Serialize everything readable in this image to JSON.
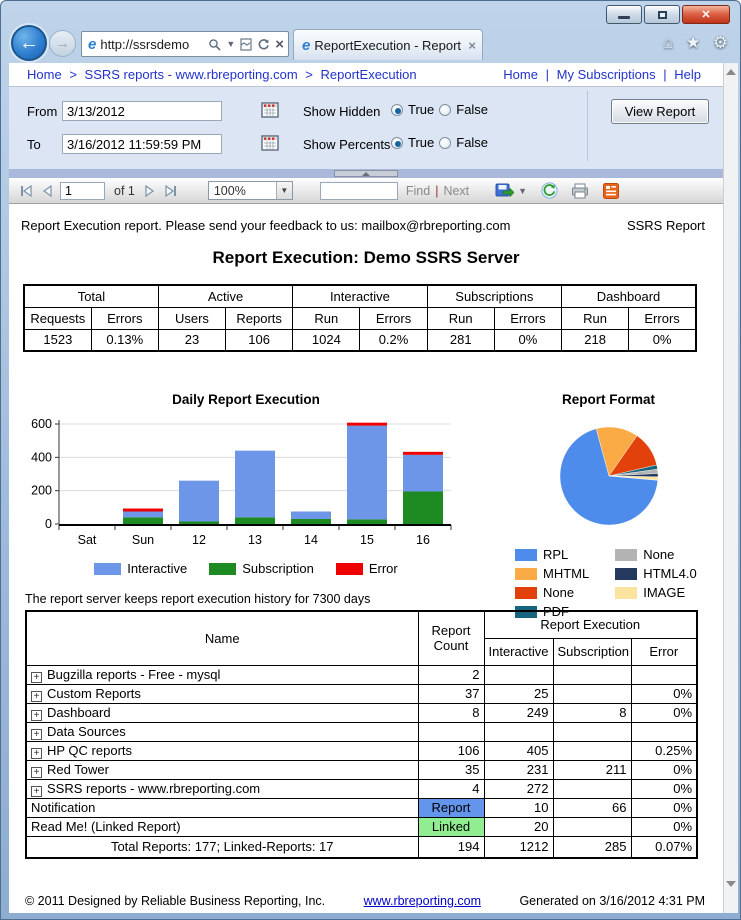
{
  "window": {
    "url": "http://ssrsdemo",
    "tab_title": "ReportExecution - Report ..."
  },
  "breadcrumb": {
    "items": [
      "Home",
      "SSRS reports - www.rbreporting.com",
      "ReportExecution"
    ],
    "separator": ">",
    "links": [
      "Home",
      "My Subscriptions",
      "Help"
    ],
    "link_separator": "|"
  },
  "params": {
    "from_label": "From",
    "from_value": "3/13/2012",
    "to_label": "To",
    "to_value": "3/16/2012 11:59:59 PM",
    "show_hidden_label": "Show Hidden",
    "show_percents_label": "Show Percents",
    "true_label": "True",
    "false_label": "False",
    "view_report_label": "View Report"
  },
  "toolbar": {
    "page_value": "1",
    "of_label": "of 1",
    "zoom_value": "100%",
    "find_label": "Find",
    "next_label": "Next",
    "find_next_separator": "|"
  },
  "report": {
    "feedback_line": "Report Execution report. Please send your feedback to us: mailbox@rbreporting.com",
    "type_label": "SSRS Report",
    "title": "Report Execution: Demo SSRS Server",
    "history_note": "The report server keeps report execution history for 7300 days"
  },
  "summary": {
    "groups": [
      {
        "label": "Total",
        "cols": [
          {
            "label": "Requests",
            "value": "1523"
          },
          {
            "label": "Errors",
            "value": "0.13%"
          }
        ]
      },
      {
        "label": "Active",
        "cols": [
          {
            "label": "Users",
            "value": "23"
          },
          {
            "label": "Reports",
            "value": "106"
          }
        ]
      },
      {
        "label": "Interactive",
        "cols": [
          {
            "label": "Run",
            "value": "1024"
          },
          {
            "label": "Errors",
            "value": "0.2%"
          }
        ]
      },
      {
        "label": "Subscriptions",
        "cols": [
          {
            "label": "Run",
            "value": "281"
          },
          {
            "label": "Errors",
            "value": "0%"
          }
        ]
      },
      {
        "label": "Dashboard",
        "cols": [
          {
            "label": "Run",
            "value": "218"
          },
          {
            "label": "Errors",
            "value": "0%"
          }
        ]
      }
    ]
  },
  "chart_data": [
    {
      "type": "bar",
      "stacked": true,
      "title": "Daily Report Execution",
      "categories": [
        "Sat",
        "Sun",
        "12",
        "13",
        "14",
        "15",
        "16"
      ],
      "series": [
        {
          "name": "Subscription",
          "color": "#1e8b22",
          "values": [
            0,
            40,
            15,
            40,
            30,
            28,
            195
          ]
        },
        {
          "name": "Interactive",
          "color": "#6d96e8",
          "values": [
            0,
            35,
            245,
            400,
            45,
            562,
            220
          ]
        },
        {
          "name": "Error",
          "color": "#ee0000",
          "values": [
            0,
            6,
            0,
            0,
            0,
            6,
            6
          ]
        }
      ],
      "legend_order": [
        "Interactive",
        "Subscription",
        "Error"
      ],
      "ylim": [
        0,
        600
      ],
      "yticks": [
        0,
        200,
        400,
        600
      ],
      "grid": true,
      "legend_position": "bottom"
    },
    {
      "type": "pie",
      "title": "Report Format",
      "start_angle": 95,
      "legend_position": "bottom",
      "slices": [
        {
          "label": "RPL",
          "value": 69.4,
          "color": "#4d8ceb"
        },
        {
          "label": "MHTML",
          "value": 13.9,
          "color": "#fbab45"
        },
        {
          "label": "None",
          "value": 11.7,
          "color": "#e2410c"
        },
        {
          "label": "PDF",
          "value": 1.4,
          "color": "#17647e"
        },
        {
          "label": "None",
          "value": 1.4,
          "color": "#b3b3b3"
        },
        {
          "label": "HTML4.0",
          "value": 1.1,
          "color": "#24395e"
        },
        {
          "label": "IMAGE",
          "value": 1.1,
          "color": "#fbe3a0"
        }
      ]
    }
  ],
  "table": {
    "name_header": "Name",
    "count_header": "Report Count",
    "exec_header": "Report Execution",
    "exec_cols": [
      "Interactive",
      "Subscription",
      "Error"
    ],
    "rows": [
      {
        "expand": true,
        "name": "Bugzilla reports - Free - mysql",
        "count": "2",
        "interactive": "",
        "subscription": "",
        "error": ""
      },
      {
        "expand": true,
        "name": "Custom Reports",
        "count": "37",
        "interactive": "25",
        "subscription": "",
        "error": "0%"
      },
      {
        "expand": true,
        "name": "Dashboard",
        "count": "8",
        "interactive": "249",
        "subscription": "8",
        "error": "0%"
      },
      {
        "expand": true,
        "name": "Data Sources",
        "count": "",
        "interactive": "",
        "subscription": "",
        "error": ""
      },
      {
        "expand": true,
        "name": "HP QC reports",
        "count": "106",
        "interactive": "405",
        "subscription": "",
        "error": "0.25%"
      },
      {
        "expand": true,
        "name": "Red Tower",
        "count": "35",
        "interactive": "231",
        "subscription": "211",
        "error": "0%"
      },
      {
        "expand": true,
        "name": "SSRS reports - www.rbreporting.com",
        "count": "4",
        "interactive": "272",
        "subscription": "",
        "error": "0%"
      },
      {
        "expand": false,
        "name": "Notification",
        "badge": {
          "text": "Report",
          "color": "#6495ed"
        },
        "interactive": "10",
        "subscription": "66",
        "error": "0%"
      },
      {
        "expand": false,
        "name": "Read Me! (Linked Report)",
        "badge": {
          "text": "Linked",
          "color": "#90ee90"
        },
        "interactive": "20",
        "subscription": "",
        "error": "0%"
      }
    ],
    "total_row": {
      "name": "Total Reports: 177; Linked-Reports: 17",
      "count": "194",
      "interactive": "1212",
      "subscription": "285",
      "error": "0.07%"
    }
  },
  "footer": {
    "copyright": "© 2011 Designed by Reliable Business Reporting, Inc.",
    "link": "www.rbreporting.com",
    "generated": "Generated on 3/16/2012 4:31 PM"
  }
}
